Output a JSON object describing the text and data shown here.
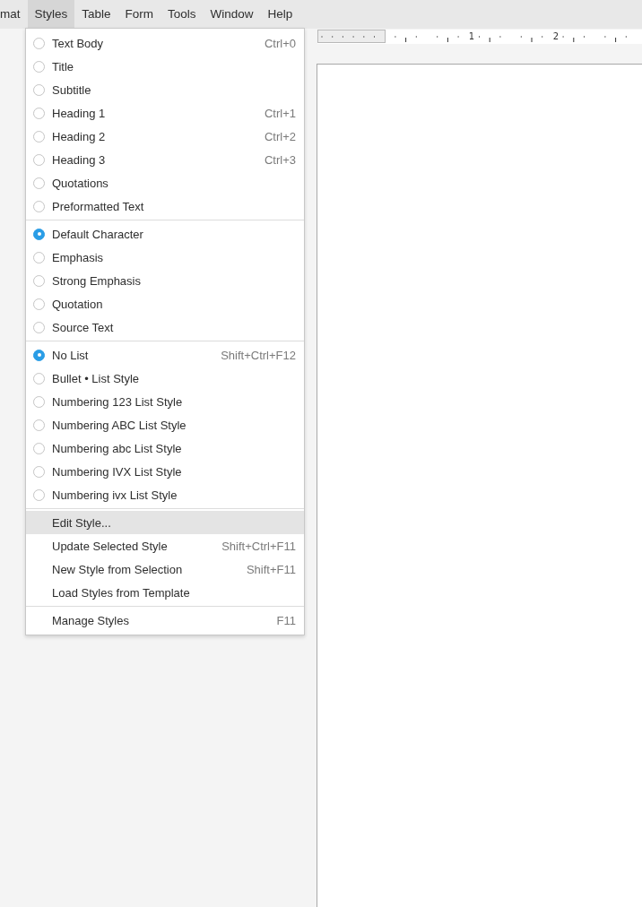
{
  "menubar": [
    {
      "label": "mat",
      "selected": false
    },
    {
      "label": "Styles",
      "selected": true
    },
    {
      "label": "Table",
      "selected": false
    },
    {
      "label": "Form",
      "selected": false
    },
    {
      "label": "Tools",
      "selected": false
    },
    {
      "label": "Window",
      "selected": false
    },
    {
      "label": "Help",
      "selected": false
    }
  ],
  "ruler": {
    "labels": [
      "1",
      "2"
    ]
  },
  "menu": {
    "groups": [
      {
        "items": [
          {
            "kind": "radio",
            "label": "Text Body",
            "shortcut": "Ctrl+0",
            "selected": false
          },
          {
            "kind": "radio",
            "label": "Title",
            "selected": false
          },
          {
            "kind": "radio",
            "label": "Subtitle",
            "selected": false
          },
          {
            "kind": "radio",
            "label": "Heading 1",
            "shortcut": "Ctrl+1",
            "selected": false
          },
          {
            "kind": "radio",
            "label": "Heading 2",
            "shortcut": "Ctrl+2",
            "selected": false
          },
          {
            "kind": "radio",
            "label": "Heading 3",
            "shortcut": "Ctrl+3",
            "selected": false
          },
          {
            "kind": "radio",
            "label": "Quotations",
            "selected": false
          },
          {
            "kind": "radio",
            "label": "Preformatted Text",
            "selected": false
          }
        ]
      },
      {
        "items": [
          {
            "kind": "radio",
            "label": "Default Character",
            "selected": true
          },
          {
            "kind": "radio",
            "label": "Emphasis",
            "selected": false
          },
          {
            "kind": "radio",
            "label": "Strong Emphasis",
            "selected": false
          },
          {
            "kind": "radio",
            "label": "Quotation",
            "selected": false
          },
          {
            "kind": "radio",
            "label": "Source Text",
            "selected": false
          }
        ]
      },
      {
        "items": [
          {
            "kind": "radio",
            "label": "No List",
            "shortcut": "Shift+Ctrl+F12",
            "selected": true
          },
          {
            "kind": "radio",
            "label": "Bullet • List Style",
            "selected": false
          },
          {
            "kind": "radio",
            "label": "Numbering 123 List Style",
            "selected": false
          },
          {
            "kind": "radio",
            "label": "Numbering ABC List Style",
            "selected": false
          },
          {
            "kind": "radio",
            "label": "Numbering abc List Style",
            "selected": false
          },
          {
            "kind": "radio",
            "label": "Numbering IVX List Style",
            "selected": false
          },
          {
            "kind": "radio",
            "label": "Numbering ivx List Style",
            "selected": false
          }
        ]
      },
      {
        "items": [
          {
            "kind": "plain",
            "label": "Edit Style...",
            "highlighted": true
          },
          {
            "kind": "plain",
            "label": "Update Selected Style",
            "shortcut": "Shift+Ctrl+F11",
            "highlighted": false
          },
          {
            "kind": "plain",
            "label": "New Style from Selection",
            "shortcut": "Shift+F11",
            "highlighted": false
          },
          {
            "kind": "plain",
            "label": "Load Styles from Template",
            "highlighted": false
          }
        ]
      },
      {
        "items": [
          {
            "kind": "plain",
            "label": "Manage Styles",
            "shortcut": "F11",
            "highlighted": false
          }
        ]
      }
    ]
  }
}
